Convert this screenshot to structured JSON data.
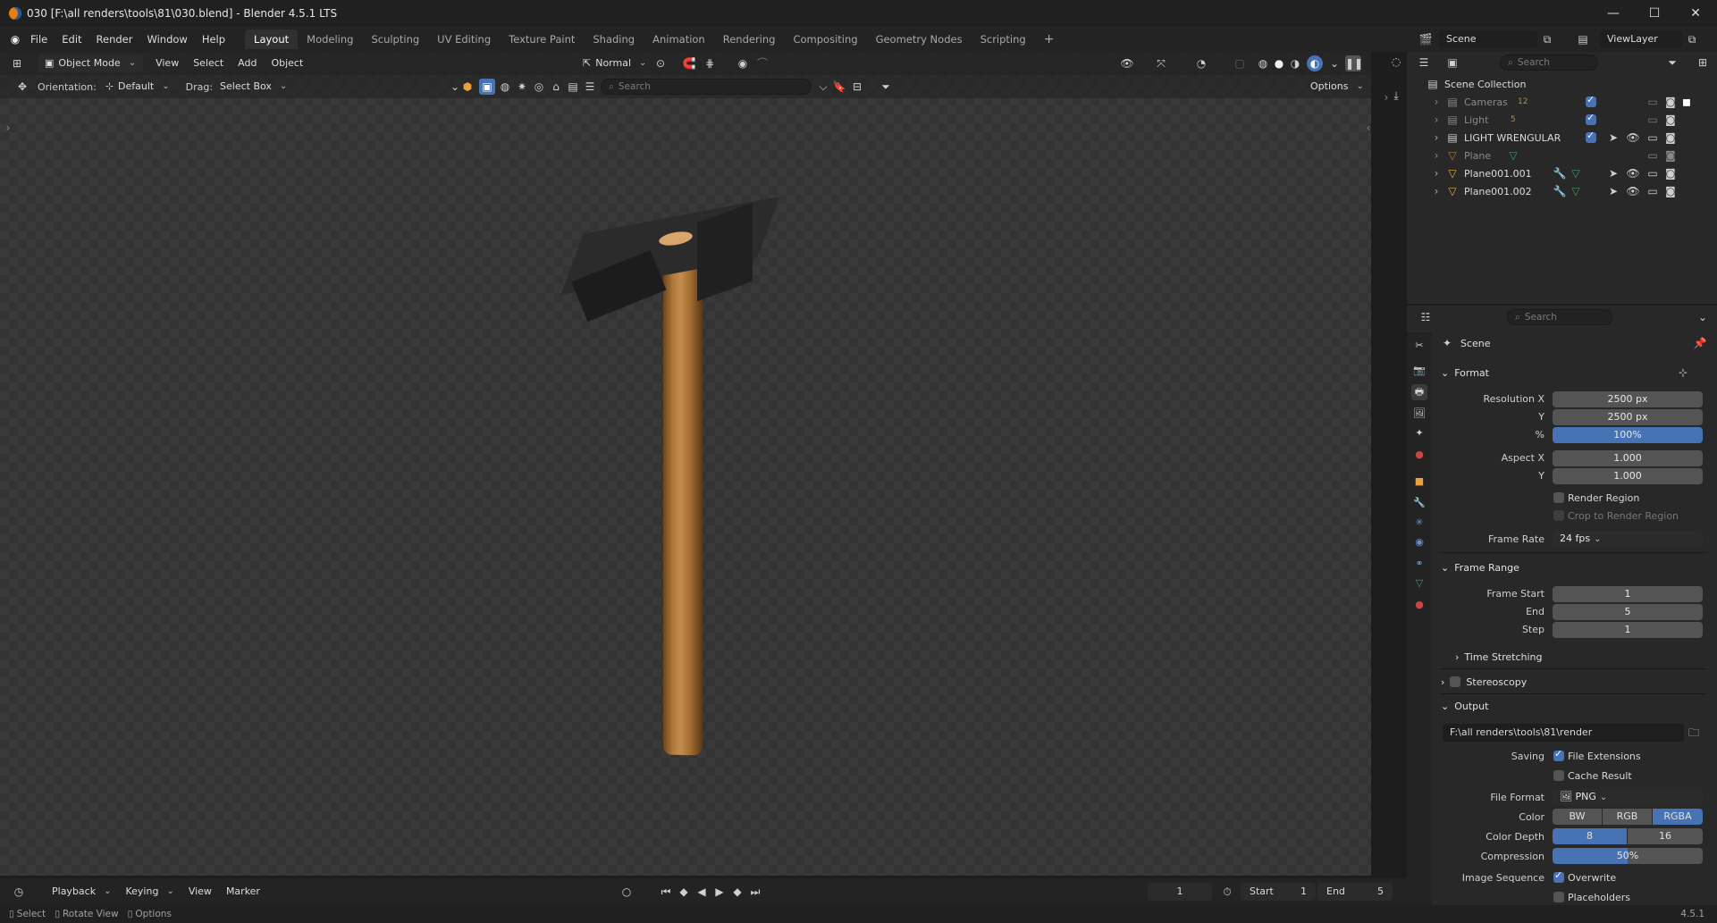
{
  "window": {
    "title": "030 [F:\\all renders\\tools\\81\\030.blend] - Blender 4.5.1 LTS",
    "minimize": "—",
    "maximize": "☐",
    "close": "✕"
  },
  "menu": {
    "items": [
      "File",
      "Edit",
      "Render",
      "Window",
      "Help"
    ]
  },
  "workspaces": {
    "tabs": [
      "Layout",
      "Modeling",
      "Sculpting",
      "UV Editing",
      "Texture Paint",
      "Shading",
      "Animation",
      "Rendering",
      "Compositing",
      "Geometry Nodes",
      "Scripting"
    ],
    "active": "Layout",
    "add": "+"
  },
  "viewport": {
    "mode": "Object Mode",
    "menus": [
      "View",
      "Select",
      "Add",
      "Object"
    ],
    "transform_orientation": "Normal",
    "orientation_label": "Orientation:",
    "orientation_value": "Default",
    "drag_label": "Drag:",
    "drag_value": "Select Box",
    "search_placeholder": "Search",
    "options": "Options"
  },
  "scene_selector": {
    "scene": "Scene",
    "view_layer": "ViewLayer"
  },
  "outliner": {
    "search_placeholder": "Search",
    "root": "Scene Collection",
    "items": [
      {
        "name": "Cameras",
        "badge": "12",
        "dim": true
      },
      {
        "name": "Light",
        "badge": "5",
        "dim": true
      },
      {
        "name": "LIGHT WRENGULAR",
        "badge": "",
        "dim": false
      },
      {
        "name": "Plane",
        "badge": "",
        "dim": true
      },
      {
        "name": "Plane001.001",
        "badge": "",
        "dim": false
      },
      {
        "name": "Plane001.002",
        "badge": "",
        "dim": false
      }
    ]
  },
  "properties": {
    "search_placeholder": "Search",
    "context": "Scene",
    "format": {
      "header": "Format",
      "resolution_x_label": "Resolution X",
      "resolution_x": "2500 px",
      "resolution_y_label": "Y",
      "resolution_y": "2500 px",
      "percent_label": "%",
      "percent": "100%",
      "aspect_x_label": "Aspect X",
      "aspect_x": "1.000",
      "aspect_y_label": "Y",
      "aspect_y": "1.000",
      "render_region": "Render Region",
      "crop_region": "Crop to Render Region",
      "frame_rate_label": "Frame Rate",
      "frame_rate": "24 fps"
    },
    "frame_range": {
      "header": "Frame Range",
      "start_label": "Frame Start",
      "start": "1",
      "end_label": "End",
      "end": "5",
      "step_label": "Step",
      "step": "1",
      "time_stretching": "Time Stretching"
    },
    "stereoscopy": {
      "header": "Stereoscopy"
    },
    "output": {
      "header": "Output",
      "path": "F:\\all renders\\tools\\81\\render",
      "saving_label": "Saving",
      "file_extensions": "File Extensions",
      "cache_result": "Cache Result",
      "file_format_label": "File Format",
      "file_format": "PNG",
      "color_label": "Color",
      "color_options": [
        "BW",
        "RGB",
        "RGBA"
      ],
      "color_selected": "RGBA",
      "color_depth_label": "Color Depth",
      "depth_options": [
        "8",
        "16"
      ],
      "depth_selected": "8",
      "compression_label": "Compression",
      "compression": "50%",
      "image_sequence_label": "Image Sequence",
      "overwrite": "Overwrite",
      "placeholders": "Placeholders"
    }
  },
  "timeline": {
    "menus": [
      "Playback",
      "Keying",
      "View",
      "Marker"
    ],
    "current_frame": "1",
    "start_label": "Start",
    "start": "1",
    "end_label": "End",
    "end": "5"
  },
  "status": {
    "select": "Select",
    "rotate": "Rotate View",
    "options": "Options",
    "version": "4.5.1"
  },
  "colors": {
    "accent": "#4772b3",
    "orange": "#e87d0d"
  }
}
